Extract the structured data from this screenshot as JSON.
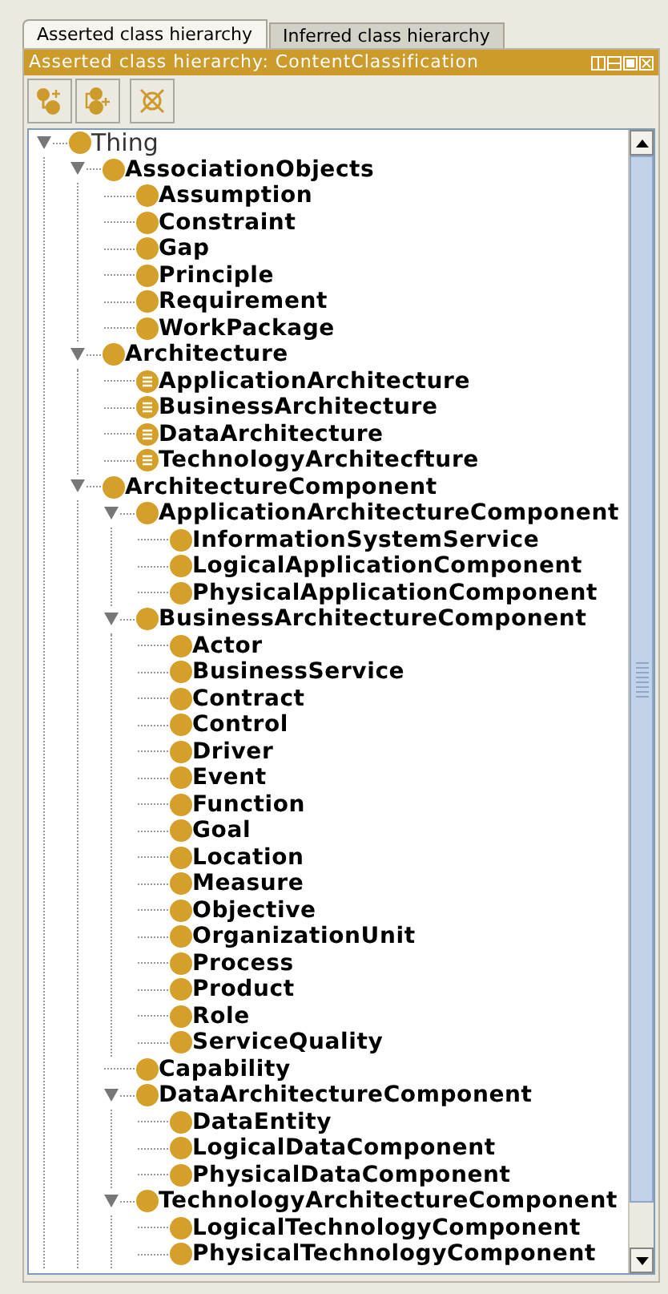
{
  "tabs": [
    {
      "label": "Asserted class hierarchy",
      "selected": true
    },
    {
      "label": "Inferred class hierarchy",
      "selected": false
    }
  ],
  "view": {
    "title": "Asserted class hierarchy: ContentClassification"
  },
  "toolbar": [
    {
      "kind": "add-subclass"
    },
    {
      "kind": "add-sibling"
    },
    {
      "kind": "delete"
    }
  ],
  "tree": [
    {
      "label": "Thing",
      "kind": "class",
      "bold": false,
      "expanded": true,
      "children": [
        {
          "label": "AssociationObjects",
          "kind": "class",
          "bold": true,
          "expanded": true,
          "children": [
            {
              "label": "Assumption",
              "kind": "class",
              "bold": true
            },
            {
              "label": "Constraint",
              "kind": "class",
              "bold": true
            },
            {
              "label": "Gap",
              "kind": "class",
              "bold": true
            },
            {
              "label": "Principle",
              "kind": "class",
              "bold": true
            },
            {
              "label": "Requirement",
              "kind": "class",
              "bold": true
            },
            {
              "label": "WorkPackage",
              "kind": "class",
              "bold": true
            }
          ]
        },
        {
          "label": "Architecture",
          "kind": "class",
          "bold": true,
          "expanded": true,
          "children": [
            {
              "label": "ApplicationArchitecture",
              "kind": "defined",
              "bold": true
            },
            {
              "label": "BusinessArchitecture",
              "kind": "defined",
              "bold": true
            },
            {
              "label": "DataArchitecture",
              "kind": "defined",
              "bold": true
            },
            {
              "label": "TechnologyArchitecfture",
              "kind": "defined",
              "bold": true
            }
          ]
        },
        {
          "label": "ArchitectureComponent",
          "kind": "class",
          "bold": true,
          "expanded": true,
          "children": [
            {
              "label": "ApplicationArchitectureComponent",
              "kind": "class",
              "bold": true,
              "expanded": true,
              "children": [
                {
                  "label": "InformationSystemService",
                  "kind": "class",
                  "bold": true
                },
                {
                  "label": "LogicalApplicationComponent",
                  "kind": "class",
                  "bold": true
                },
                {
                  "label": "PhysicalApplicationComponent",
                  "kind": "class",
                  "bold": true
                }
              ]
            },
            {
              "label": "BusinessArchitectureComponent",
              "kind": "class",
              "bold": true,
              "expanded": true,
              "children": [
                {
                  "label": "Actor",
                  "kind": "class",
                  "bold": true
                },
                {
                  "label": "BusinessService",
                  "kind": "class",
                  "bold": true
                },
                {
                  "label": "Contract",
                  "kind": "class",
                  "bold": true
                },
                {
                  "label": "Control",
                  "kind": "class",
                  "bold": true
                },
                {
                  "label": "Driver",
                  "kind": "class",
                  "bold": true
                },
                {
                  "label": "Event",
                  "kind": "class",
                  "bold": true
                },
                {
                  "label": "Function",
                  "kind": "class",
                  "bold": true
                },
                {
                  "label": "Goal",
                  "kind": "class",
                  "bold": true
                },
                {
                  "label": "Location",
                  "kind": "class",
                  "bold": true
                },
                {
                  "label": "Measure",
                  "kind": "class",
                  "bold": true
                },
                {
                  "label": "Objective",
                  "kind": "class",
                  "bold": true
                },
                {
                  "label": "OrganizationUnit",
                  "kind": "class",
                  "bold": true
                },
                {
                  "label": "Process",
                  "kind": "class",
                  "bold": true
                },
                {
                  "label": "Product",
                  "kind": "class",
                  "bold": true
                },
                {
                  "label": "Role",
                  "kind": "class",
                  "bold": true
                },
                {
                  "label": "ServiceQuality",
                  "kind": "class",
                  "bold": true
                }
              ]
            },
            {
              "label": "Capability",
              "kind": "class",
              "bold": true
            },
            {
              "label": "DataArchitectureComponent",
              "kind": "class",
              "bold": true,
              "expanded": true,
              "children": [
                {
                  "label": "DataEntity",
                  "kind": "class",
                  "bold": true
                },
                {
                  "label": "LogicalDataComponent",
                  "kind": "class",
                  "bold": true
                },
                {
                  "label": "PhysicalDataComponent",
                  "kind": "class",
                  "bold": true
                }
              ]
            },
            {
              "label": "TechnologyArchitectureComponent",
              "kind": "class",
              "bold": true,
              "expanded": true,
              "children": [
                {
                  "label": "LogicalTechnologyComponent",
                  "kind": "class",
                  "bold": true
                },
                {
                  "label": "PhysicalTechnologyComponent",
                  "kind": "class",
                  "bold": true
                }
              ]
            }
          ]
        }
      ]
    }
  ]
}
